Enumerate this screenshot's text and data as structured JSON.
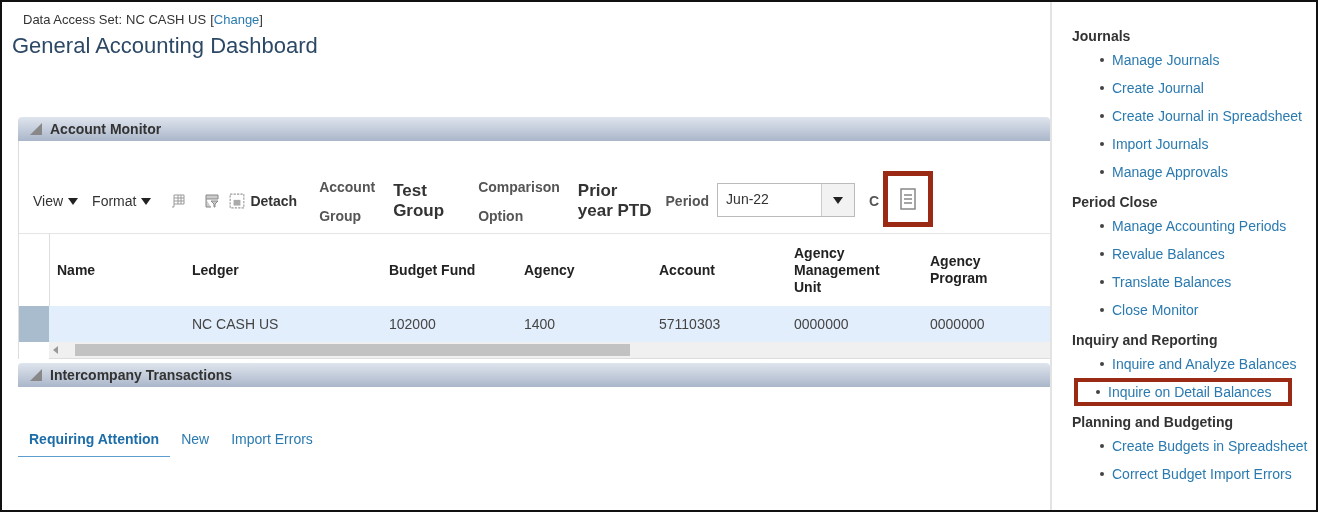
{
  "header": {
    "data_access_label": "Data Access Set:",
    "data_access_value": "NC CASH US",
    "bracket_open": "[",
    "change_link": "Change",
    "bracket_close": "]",
    "title": "General Accounting Dashboard"
  },
  "account_monitor": {
    "title": "Account Monitor",
    "expanded": true,
    "toolbar": {
      "view": "View",
      "format": "Format",
      "detach": "Detach",
      "account_group_label": [
        "Account",
        "Group"
      ],
      "account_group_value": [
        "Test",
        "Group"
      ],
      "comparison_label": [
        "Comparison",
        "Option"
      ],
      "comparison_value": [
        "Prior",
        "year PTD"
      ],
      "period_label": "Period",
      "period_value": "Jun-22",
      "cut_label": "C",
      "layout_icon_highlighted": true
    },
    "table": {
      "columns": [
        "Name",
        "Ledger",
        "Budget Fund",
        "Agency",
        "Account",
        "Agency Management Unit",
        "Agency Program"
      ],
      "rows": [
        {
          "selected": true,
          "cells": [
            "",
            "NC CASH US",
            "102000",
            "1400",
            "57110303",
            "0000000",
            "0000000"
          ]
        }
      ]
    }
  },
  "intercompany": {
    "title": "Intercompany Transactions",
    "expanded": true,
    "tabs": [
      {
        "label": "Requiring Attention",
        "selected": true
      },
      {
        "label": "New",
        "selected": false
      },
      {
        "label": "Import Errors",
        "selected": false
      }
    ]
  },
  "task_panel": [
    {
      "heading": "Journals",
      "links": [
        {
          "label": "Manage Journals",
          "highlighted": false
        },
        {
          "label": "Create Journal",
          "highlighted": false
        },
        {
          "label": "Create Journal in Spreadsheet",
          "highlighted": false
        },
        {
          "label": "Import Journals",
          "highlighted": false
        },
        {
          "label": "Manage Approvals",
          "highlighted": false
        }
      ]
    },
    {
      "heading": "Period Close",
      "links": [
        {
          "label": "Manage Accounting Periods",
          "highlighted": false
        },
        {
          "label": "Revalue Balances",
          "highlighted": false
        },
        {
          "label": "Translate Balances",
          "highlighted": false
        },
        {
          "label": "Close Monitor",
          "highlighted": false
        }
      ]
    },
    {
      "heading": "Inquiry and Reporting",
      "links": [
        {
          "label": "Inquire and Analyze Balances",
          "highlighted": false
        },
        {
          "label": "Inquire on Detail Balances",
          "highlighted": true
        }
      ]
    },
    {
      "heading": "Planning and Budgeting",
      "links": [
        {
          "label": "Create Budgets in Spreadsheet",
          "highlighted": false
        },
        {
          "label": "Correct Budget Import Errors",
          "highlighted": false
        }
      ]
    }
  ]
}
